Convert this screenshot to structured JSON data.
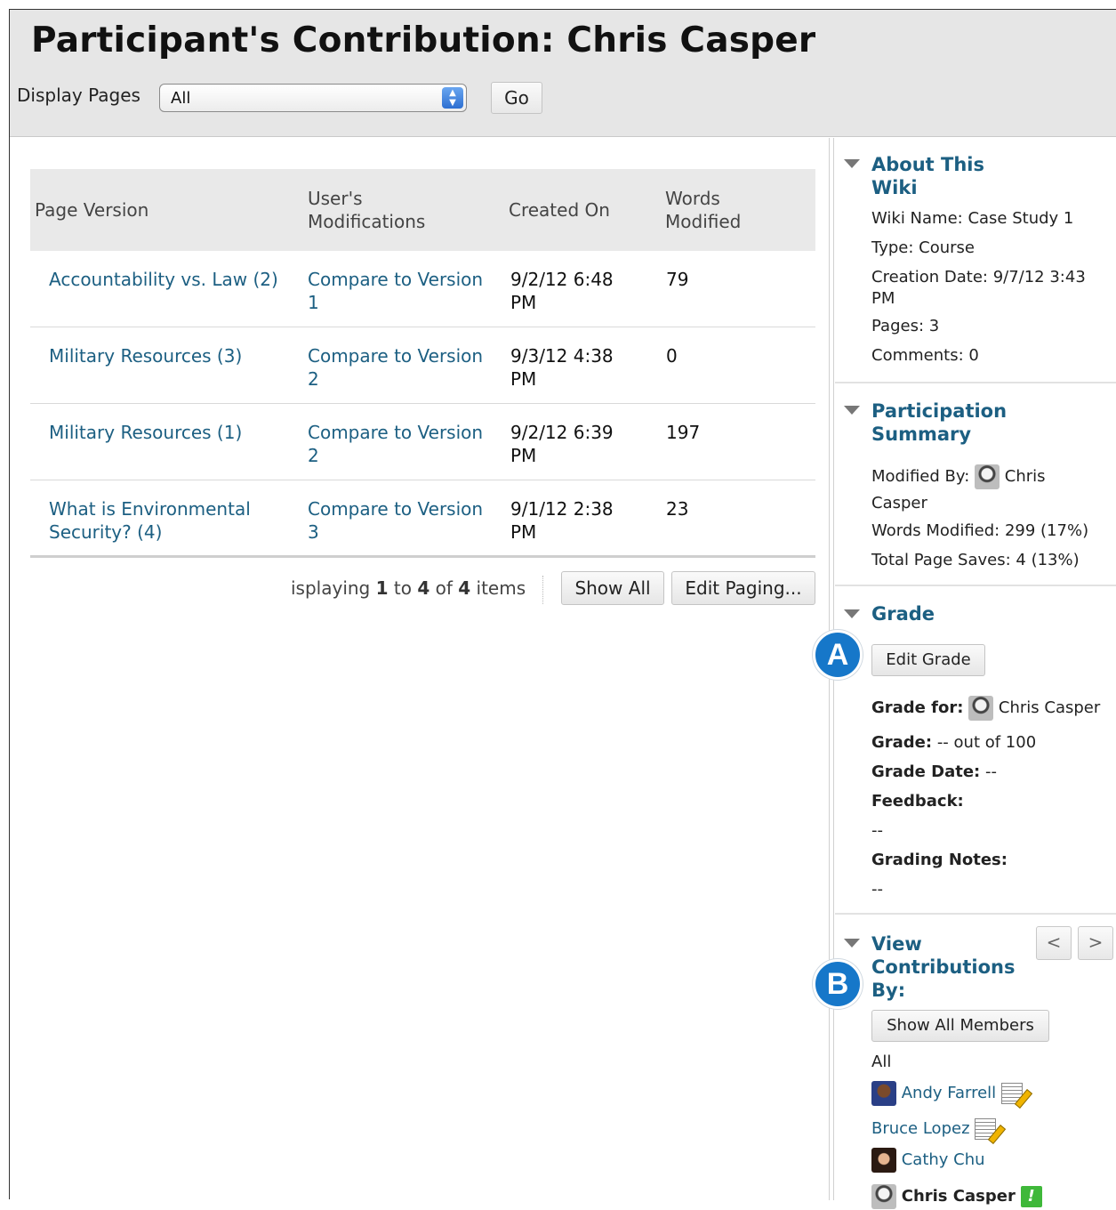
{
  "header": {
    "title": "Participant's Contribution: Chris Casper",
    "display_label": "Display Pages",
    "display_value": "All",
    "go_label": "Go"
  },
  "table": {
    "headers": [
      "Page Version",
      "User's Modifications",
      "Created On",
      "Words Modified"
    ],
    "rows": [
      {
        "page": "Accountability vs. Law (2)",
        "mod": "Compare to Version 1",
        "created": "9/2/12 6:48 PM",
        "words": "79"
      },
      {
        "page": "Military Resources (3)",
        "mod": "Compare to Version 2",
        "created": "9/3/12 4:38 PM",
        "words": "0"
      },
      {
        "page": "Military Resources (1)",
        "mod": "Compare to Version 2",
        "created": "9/2/12 6:39 PM",
        "words": "197"
      },
      {
        "page": "What is Environmental Security? (4)",
        "mod": "Compare to Version 3",
        "created": "9/1/12 2:38 PM",
        "words": "23"
      }
    ]
  },
  "paging": {
    "prefix": "isplaying ",
    "from": "1",
    "to_word": " to ",
    "to": "4",
    "of_word": " of ",
    "total": "4",
    "suffix": " items",
    "show_all": "Show All",
    "edit_paging": "Edit Paging..."
  },
  "about": {
    "title": "About This Wiki",
    "wiki_name": "Wiki Name: Case Study 1",
    "type": "Type: Course",
    "creation_date": "Creation Date:  9/7/12 3:43 PM",
    "pages": "Pages: 3",
    "comments": "Comments: 0"
  },
  "participation": {
    "title": "Participation Summary",
    "modified_by_label": "Modified By:",
    "modified_by_name": "Chris Casper",
    "words_modified": "Words Modified: 299 (17%)",
    "total_saves": "Total Page Saves: 4 (13%)"
  },
  "grade": {
    "title": "Grade",
    "badge": "A",
    "edit_grade": "Edit Grade",
    "grade_for_label": "Grade for:",
    "grade_for_name": "Chris Casper",
    "grade_label": "Grade:",
    "grade_value": " -- out of 100",
    "grade_date_label": "Grade Date:",
    "grade_date_value": " --",
    "feedback_label": "Feedback:",
    "feedback_value": "--",
    "notes_label": "Grading Notes:",
    "notes_value": "--"
  },
  "contributions": {
    "title": "View Contributions By:",
    "badge": "B",
    "prev": "<",
    "next": ">",
    "show_all_members": "Show All Members",
    "all": "All",
    "members": [
      "Andy Farrell",
      "Bruce Lopez",
      "Cathy Chu",
      "Chris Casper"
    ],
    "current_marker": "!"
  }
}
